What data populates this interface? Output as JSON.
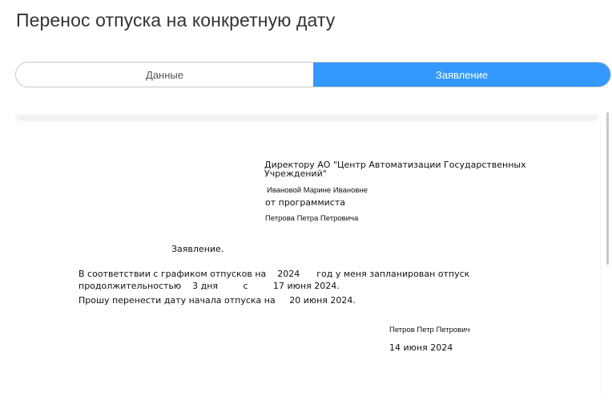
{
  "page": {
    "title": "Перенос отпуска на конкретную дату"
  },
  "tabs": [
    {
      "label": "Данные",
      "active": false
    },
    {
      "label": "Заявление",
      "active": true
    }
  ],
  "document": {
    "addressee_line1": "Директору АО \"Центр Автоматизации Государственных",
    "addressee_line2": "Учреждений\"",
    "director_name": "Ивановой Марине Ивановне",
    "from_position": "от программиста",
    "from_name": "Петрова Петра Петровича",
    "heading": "Заявление.",
    "body_line1": "В соответствии с графиком отпусков на    2024      год у меня запланирован отпуск",
    "body_line2": "продолжительностью    3 дня         с         17 июня 2024.",
    "body_line3": "Прошу перенести дату начала отпуска на     20 июня 2024.",
    "signature_name": "Петров Петр Петрович",
    "signature_date": "14 июня 2024"
  },
  "colors": {
    "accent": "#3399ff",
    "scrollbar": "#c8c8c8"
  }
}
